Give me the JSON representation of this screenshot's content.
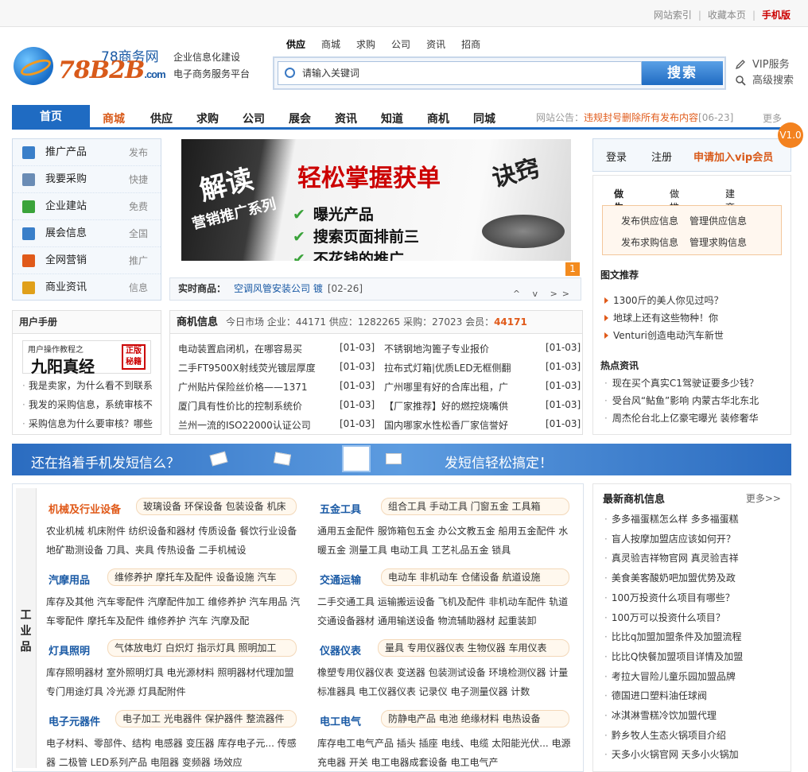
{
  "topbar": {
    "site_index": "网站索引",
    "bookmark": "收藏本页",
    "mobile": "手机版"
  },
  "logo": {
    "cn_name": "78商务网",
    "brand": "78B2B",
    "brand_suffix": ".com"
  },
  "slogan": {
    "line1": "企业信息化建设",
    "line2": "电子商务服务平台"
  },
  "search": {
    "tabs": [
      "供应",
      "商城",
      "求购",
      "公司",
      "资讯",
      "招商"
    ],
    "placeholder": "请输入关键词",
    "button": "搜索"
  },
  "vip_links": {
    "vip_service": "VIP服务",
    "advanced_search": "高级搜索"
  },
  "nav": {
    "home": "首页",
    "items": [
      "商城",
      "供应",
      "求购",
      "公司",
      "展会",
      "资讯",
      "知道",
      "商机",
      "同城"
    ],
    "notice_label": "网站公告：",
    "notice_text": "违规封号删除所有发布内容",
    "notice_date": "[06-23]",
    "more": "更多"
  },
  "left_menu": [
    {
      "icon": "supply-icon",
      "label": "推广产品",
      "tag": "发布",
      "color": "#3a7fc9"
    },
    {
      "icon": "purchase-icon",
      "label": "我要采购",
      "tag": "快捷",
      "color": "#6a8cb5"
    },
    {
      "icon": "site-icon",
      "label": "企业建站",
      "tag": "免费",
      "color": "#3aa33a"
    },
    {
      "icon": "expo-icon",
      "label": "展会信息",
      "tag": "全国",
      "color": "#3a7fc9"
    },
    {
      "icon": "marketing-icon",
      "label": "全网营销",
      "tag": "推广",
      "color": "#e05a1a"
    },
    {
      "icon": "chart-icon",
      "label": "商业资讯",
      "tag": "信息",
      "color": "#e0a01a"
    }
  ],
  "banner": {
    "t1": "解读",
    "t2": "营销推广系列",
    "t3": "轻松掌握获单",
    "t4": "诀窍",
    "l1": "曝光产品",
    "l2": "搜索页面排前三",
    "l3": "不花钱的推广",
    "page": "1"
  },
  "live": {
    "label": "实时商品：",
    "text": "空调风管安装公司 镀",
    "date": "[02-26]",
    "controls": "^ v >>"
  },
  "right_box": {
    "login": "登录",
    "register": "注册",
    "join_vip": "申请加入vip会员",
    "version": "V1.0"
  },
  "right_tabs": [
    "做生意",
    "做推广",
    "建商铺"
  ],
  "right_links": [
    "发布供应信息",
    "管理供应信息",
    "发布求购信息",
    "管理求购信息"
  ],
  "pic_rec": {
    "title": "图文推荐",
    "items": [
      "1300斤的美人你见过吗？",
      "地球上还有这些物种！你",
      "Venturi创造电动汽车新世"
    ]
  },
  "hot": {
    "title": "热点资讯",
    "items": [
      "现在买个真实C1驾驶证要多少钱？",
      "受台风“鲇鱼”影响 内蒙古华北东北",
      "周杰伦台北上亿豪宅曝光 装修奢华"
    ]
  },
  "manual": {
    "title": "用户手册",
    "img_t1": "用户操作教程之",
    "img_t2": "九阳真经",
    "img_seal": "正版秘籍",
    "items": [
      "我是卖家，为什么看不到联系",
      "我发的采购信息，系统审核不",
      "采购信息为什么要审核？哪些"
    ]
  },
  "biz": {
    "title": "商机信息",
    "stats": "今日市场  企业：44171  供应：1282265  采购：27023  会员：",
    "members": "44171",
    "rows": [
      {
        "a": "电动装置启闭机，在哪容易买",
        "ad": "[01-03]",
        "b": "不锈钢地沟篦子专业报价",
        "bd": "[01-03]"
      },
      {
        "a": "二手FT9500X射线荧光镀层厚度",
        "ad": "[01-03]",
        "b": "拉布式灯箱|优质LED无框侧翻",
        "bd": "[01-03]"
      },
      {
        "a": "广州贴片保险丝价格——1371",
        "ad": "[01-03]",
        "b": "广州哪里有好的合库出租，广",
        "bd": "[01-03]"
      },
      {
        "a": "厦门具有性价比的控制系统价",
        "ad": "[01-03]",
        "b": "【厂家推荐】好的燃控烧嘴供",
        "bd": "[01-03]"
      },
      {
        "a": "兰州一流的ISO22000认证公司",
        "ad": "[01-03]",
        "b": "国内哪家水性松香厂家信誉好",
        "bd": "[01-03]"
      }
    ]
  },
  "sms": {
    "left": "还在掐着手机发短信么？",
    "right": "发短信轻松搞定！"
  },
  "industry": {
    "side": "工业品",
    "cats": [
      {
        "name": "机械及行业设备",
        "tags": "玻璃设备 环保设备 包装设备 机床",
        "sub": "农业机械  机床附件  纺织设备和器材  传质设备  餐饮行业设备  地矿勘测设备  刀具、夹具  传热设备  二手机械设"
      },
      {
        "name": "五金工具",
        "tags": "组合工具 手动工具 门窗五金 工具箱",
        "sub": "通用五金配件  服饰箱包五金  办公文教五金  船用五金配件  水暖五金  测量工具  电动工具  工艺礼品五金  锁具"
      },
      {
        "name": "汽摩用品",
        "tags": "维修养护 摩托车及配件 设备设施 汽车",
        "sub": "库存及其他  汽车零配件  汽摩配件加工  维修养护  汽车用品  汽车零配件  摩托车及配件  维修养护  汽车  汽摩及配"
      },
      {
        "name": "交通运输",
        "tags": "电动车 非机动车 仓储设备 航道设施",
        "sub": "二手交通工具  运输搬运设备  飞机及配件  非机动车配件  轨道交通设备器材  通用输送设备  物流辅助器材  起重装卸"
      },
      {
        "name": "灯具照明",
        "tags": "气体放电灯 白炽灯 指示灯具 照明加工",
        "sub": "库存照明器材  室外照明灯具  电光源材料  照明器材代理加盟  专门用途灯具  冷光源  灯具配附件"
      },
      {
        "name": "仪器仪表",
        "tags": "量具 专用仪器仪表 生物仪器 车用仪表",
        "sub": "橡塑专用仪器仪表  变送器  包装测试设备  环境检测仪器  计量标准器具  电工仪器仪表  记录仪  电子测量仪器  计数"
      },
      {
        "name": "电子元器件",
        "tags": "电子加工 光电器件 保护器件 整流器件",
        "sub": "电子材料、零部件、结构  电感器  变压器  库存电子元...  传感器  二极管  LED系列产品  电阻器  变频器  场效应"
      },
      {
        "name": "电工电气",
        "tags": "防静电产品 电池 绝缘材料 电热设备",
        "sub": "库存电工电气产品  插头  插座  电线、电缆  太阳能光伏...  电源  充电器  开关  电工电器成套设备  电工电气产"
      }
    ]
  },
  "newbiz": {
    "title": "最新商机信息",
    "more": "更多>>",
    "items": [
      "多多福蛋糕怎么样 多多福蛋糕",
      "盲人按摩加盟店应该如何开？",
      "真灵验吉祥物官网 真灵验吉祥",
      "美食美客酸奶吧加盟优势及政",
      "100万投资什么项目有哪些？",
      "100万可以投资什么项目？",
      "比比q加盟加盟条件及加盟流程",
      "比比Q快餐加盟项目详情及加盟",
      "考拉大冒险儿童乐园加盟品牌",
      "德国进口塑料油任球阀",
      "冰淇淋雪糕冷饮加盟代理",
      "黔乡牧人生态火锅项目介绍",
      "天多小火锅官网 天多小火锅加"
    ]
  }
}
